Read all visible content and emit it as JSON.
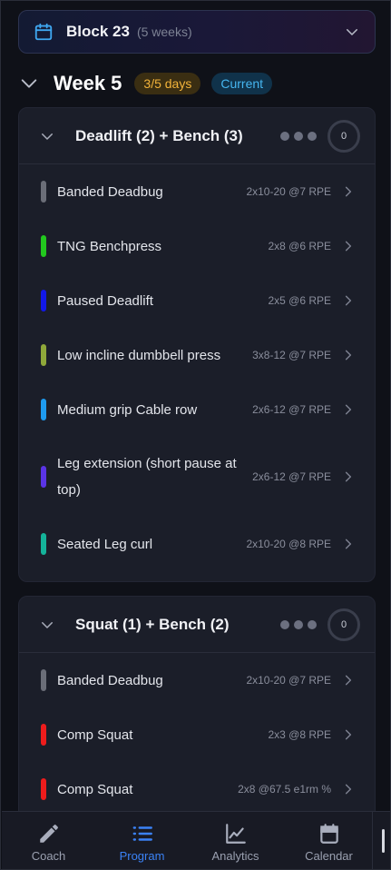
{
  "block": {
    "title": "Block 23",
    "subtitle": "(5 weeks)"
  },
  "week": {
    "title": "Week 5",
    "days_badge": "3/5 days",
    "status_badge": "Current"
  },
  "days": [
    {
      "title": "Deadlift (2) + Bench (3)",
      "count": "0",
      "exercises": [
        {
          "name": "Banded Deadbug",
          "spec": "2x10-20 @7 RPE",
          "color": "#6b6e78"
        },
        {
          "name": "TNG Benchpress",
          "spec": "2x8 @6 RPE",
          "color": "#22c81e"
        },
        {
          "name": "Paused Deadlift",
          "spec": "2x5 @6 RPE",
          "color": "#1218e8"
        },
        {
          "name": "Low incline dumbbell press",
          "spec": "3x8-12 @7 RPE",
          "color": "#8fa83a"
        },
        {
          "name": "Medium grip Cable row",
          "spec": "2x6-12 @7 RPE",
          "color": "#1e9bf0"
        },
        {
          "name": "Leg extension (short pause at top)",
          "spec": "2x6-12 @7 RPE",
          "color": "#5a34e6"
        },
        {
          "name": "Seated Leg curl",
          "spec": "2x10-20 @8 RPE",
          "color": "#14b39a"
        }
      ]
    },
    {
      "title": "Squat (1) + Bench (2)",
      "count": "0",
      "exercises": [
        {
          "name": "Banded Deadbug",
          "spec": "2x10-20 @7 RPE",
          "color": "#6b6e78"
        },
        {
          "name": "Comp Squat",
          "spec": "2x3 @8 RPE",
          "color": "#ee1c1c"
        },
        {
          "name": "Comp Squat",
          "spec": "2x8 @67.5 e1rm %",
          "color": "#ee1c1c"
        }
      ]
    }
  ],
  "nav": [
    {
      "label": "Coach",
      "icon": "pencil-icon",
      "active": false
    },
    {
      "label": "Program",
      "icon": "list-icon",
      "active": true
    },
    {
      "label": "Analytics",
      "icon": "chart-icon",
      "active": false
    },
    {
      "label": "Calendar",
      "icon": "calendar-icon",
      "active": false
    }
  ],
  "colors": {
    "accent": "#3b82f6",
    "days_badge_text": "#f2b33a",
    "current_badge_text": "#46b6f0"
  }
}
